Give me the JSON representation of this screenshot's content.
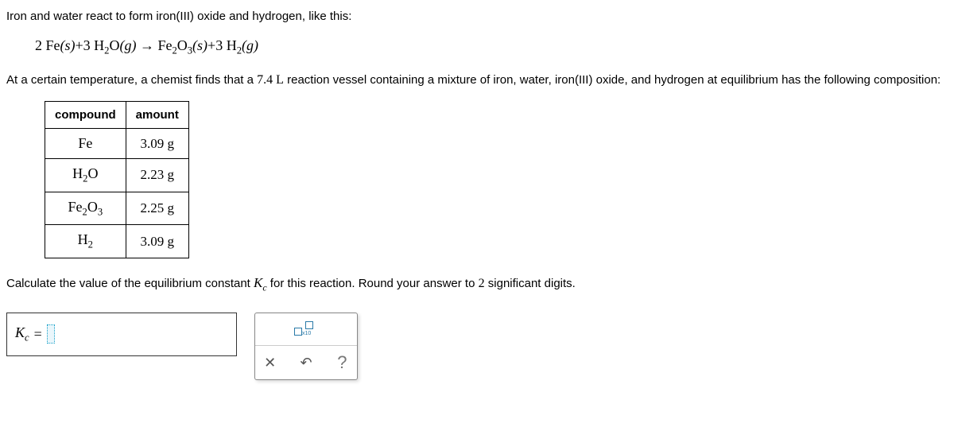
{
  "intro": "Iron and water react to form iron(III) oxide and hydrogen, like this:",
  "equation": {
    "lhs1_coef": "2",
    "lhs1": "Fe",
    "lhs1_state": "(s)",
    "lhs2_coef": "3",
    "lhs2": "H",
    "lhs2_sub": "2",
    "lhs2b": "O",
    "lhs2_state": "(g)",
    "rhs1": "Fe",
    "rhs1_sub1": "2",
    "rhs1b": "O",
    "rhs1_sub2": "3",
    "rhs1_state": "(s)",
    "rhs2_coef": "3",
    "rhs2": "H",
    "rhs2_sub": "2",
    "rhs2_state": "(g)"
  },
  "context_a": "At a certain temperature, a chemist finds that a ",
  "vessel_vol": "7.4 L",
  "context_b": " reaction vessel containing a mixture of iron, water, iron(III) oxide, and hydrogen at equilibrium has the following composition:",
  "table": {
    "head_compound": "compound",
    "head_amount": "amount",
    "rows": [
      {
        "compound_html": "Fe",
        "amount": "3.09 g"
      },
      {
        "compound_html": "H<sub>2</sub>O",
        "amount": "2.23 g"
      },
      {
        "compound_html": "Fe<sub>2</sub>O<sub>3</sub>",
        "amount": "2.25 g"
      },
      {
        "compound_html": "H<sub>2</sub>",
        "amount": "3.09 g"
      }
    ]
  },
  "question_a": "Calculate the value of the equilibrium constant ",
  "kc_symbol": "K",
  "kc_sub": "c",
  "question_b": " for this reaction. Round your answer to ",
  "sigfigs": "2",
  "question_c": " significant digits.",
  "answer": {
    "kc_label": "K",
    "kc_sub": "c",
    "equals": " = "
  },
  "toolbar": {
    "sci_label": "x10",
    "clear": "✕",
    "undo": "↶",
    "help": "?"
  }
}
